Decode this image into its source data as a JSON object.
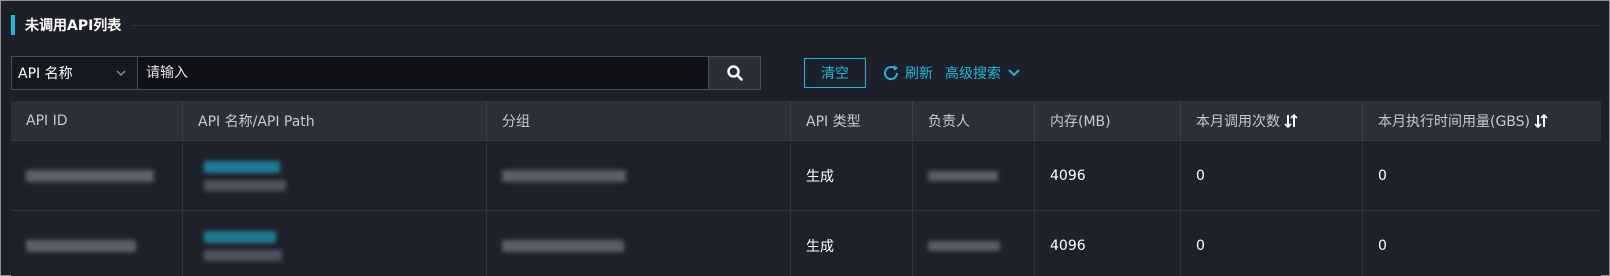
{
  "section": {
    "title": "未调用API列表"
  },
  "search": {
    "field_selected": "API 名称",
    "placeholder": "请输入"
  },
  "actions": {
    "clear_label": "清空",
    "refresh_label": "刷新",
    "advanced_label": "高级搜索"
  },
  "colors": {
    "accent": "#1eb8d8",
    "background": "#1e2029",
    "header_bg": "#2c2f3a"
  },
  "table": {
    "columns": [
      {
        "label": "API ID",
        "sortable": false
      },
      {
        "label": "API 名称/API Path",
        "sortable": false
      },
      {
        "label": "分组",
        "sortable": false
      },
      {
        "label": "API 类型",
        "sortable": false
      },
      {
        "label": "负责人",
        "sortable": false
      },
      {
        "label": "内存(MB)",
        "sortable": false
      },
      {
        "label": "本月调用次数",
        "sortable": true
      },
      {
        "label": "本月执行时间用量(GBS)",
        "sortable": true
      }
    ],
    "rows": [
      {
        "api_type": "生成",
        "memory": "4096",
        "calls": "0",
        "exec_usage": "0"
      },
      {
        "api_type": "生成",
        "memory": "4096",
        "calls": "0",
        "exec_usage": "0"
      }
    ]
  }
}
